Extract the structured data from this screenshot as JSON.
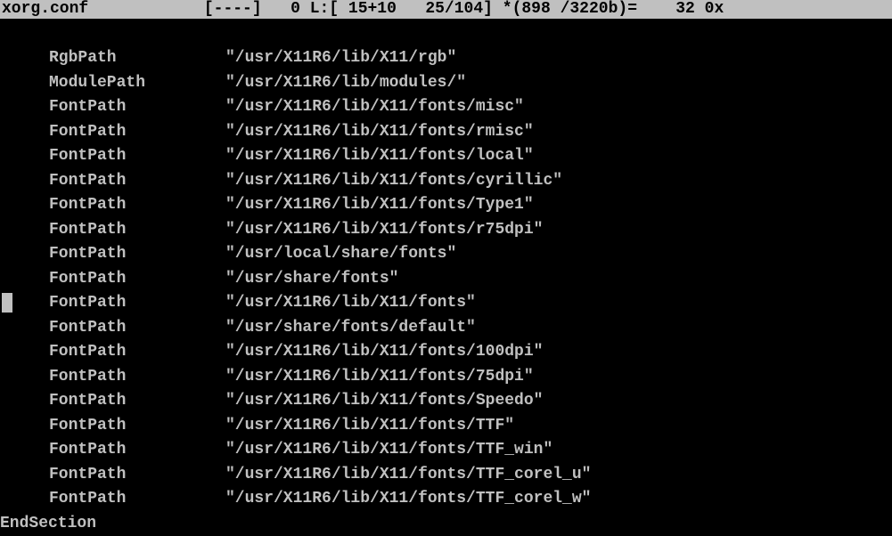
{
  "statusbar": {
    "filename": "xorg.conf",
    "flags": "[----]",
    "col": "0",
    "line_label": "L:[",
    "line_offset": "15+10",
    "line_pos": "25/104]",
    "bytes": "*(898 /3220b)=",
    "char_dec": "32",
    "char_hex": "0x"
  },
  "lines": [
    {
      "key": "RgbPath",
      "val": "\"/usr/X11R6/lib/X11/rgb\""
    },
    {
      "key": "ModulePath",
      "val": "\"/usr/X11R6/lib/modules/\""
    },
    {
      "key": "FontPath",
      "val": "\"/usr/X11R6/lib/X11/fonts/misc\""
    },
    {
      "key": "FontPath",
      "val": "\"/usr/X11R6/lib/X11/fonts/rmisc\""
    },
    {
      "key": "FontPath",
      "val": "\"/usr/X11R6/lib/X11/fonts/local\""
    },
    {
      "key": "FontPath",
      "val": "\"/usr/X11R6/lib/X11/fonts/cyrillic\""
    },
    {
      "key": "FontPath",
      "val": "\"/usr/X11R6/lib/X11/fonts/Type1\""
    },
    {
      "key": "FontPath",
      "val": "\"/usr/X11R6/lib/X11/fonts/r75dpi\""
    },
    {
      "key": "FontPath",
      "val": "\"/usr/local/share/fonts\""
    },
    {
      "key": "FontPath",
      "val": "\"/usr/share/fonts\""
    },
    {
      "key": "FontPath",
      "val": "\"/usr/X11R6/lib/X11/fonts\""
    },
    {
      "key": "FontPath",
      "val": "\"/usr/share/fonts/default\""
    },
    {
      "key": "FontPath",
      "val": "\"/usr/X11R6/lib/X11/fonts/100dpi\""
    },
    {
      "key": "FontPath",
      "val": "\"/usr/X11R6/lib/X11/fonts/75dpi\""
    },
    {
      "key": "FontPath",
      "val": "\"/usr/X11R6/lib/X11/fonts/Speedo\""
    },
    {
      "key": "FontPath",
      "val": "\"/usr/X11R6/lib/X11/fonts/TTF\""
    },
    {
      "key": "FontPath",
      "val": "\"/usr/X11R6/lib/X11/fonts/TTF_win\""
    },
    {
      "key": "FontPath",
      "val": "\"/usr/X11R6/lib/X11/fonts/TTF_corel_u\""
    },
    {
      "key": "FontPath",
      "val": "\"/usr/X11R6/lib/X11/fonts/TTF_corel_w\""
    }
  ],
  "endsection": "EndSection",
  "cursor_line_index": 10
}
